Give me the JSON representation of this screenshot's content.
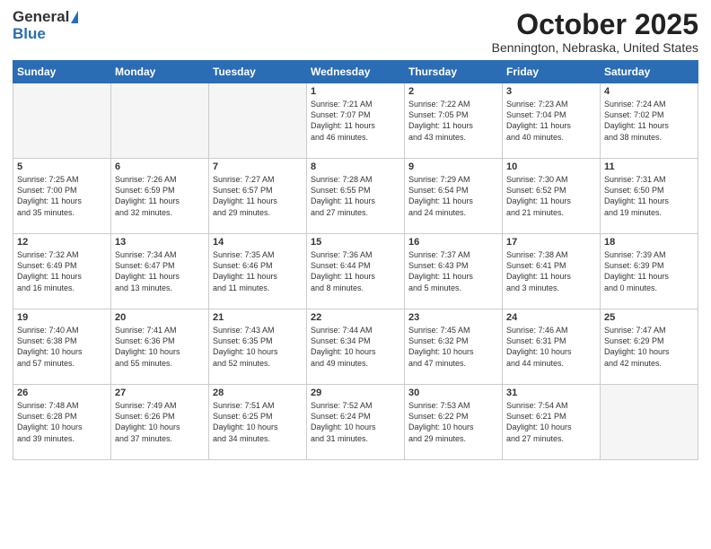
{
  "logo": {
    "general": "General",
    "blue": "Blue"
  },
  "title": "October 2025",
  "subtitle": "Bennington, Nebraska, United States",
  "days_of_week": [
    "Sunday",
    "Monday",
    "Tuesday",
    "Wednesday",
    "Thursday",
    "Friday",
    "Saturday"
  ],
  "weeks": [
    [
      {
        "day": "",
        "info": ""
      },
      {
        "day": "",
        "info": ""
      },
      {
        "day": "",
        "info": ""
      },
      {
        "day": "1",
        "info": "Sunrise: 7:21 AM\nSunset: 7:07 PM\nDaylight: 11 hours\nand 46 minutes."
      },
      {
        "day": "2",
        "info": "Sunrise: 7:22 AM\nSunset: 7:05 PM\nDaylight: 11 hours\nand 43 minutes."
      },
      {
        "day": "3",
        "info": "Sunrise: 7:23 AM\nSunset: 7:04 PM\nDaylight: 11 hours\nand 40 minutes."
      },
      {
        "day": "4",
        "info": "Sunrise: 7:24 AM\nSunset: 7:02 PM\nDaylight: 11 hours\nand 38 minutes."
      }
    ],
    [
      {
        "day": "5",
        "info": "Sunrise: 7:25 AM\nSunset: 7:00 PM\nDaylight: 11 hours\nand 35 minutes."
      },
      {
        "day": "6",
        "info": "Sunrise: 7:26 AM\nSunset: 6:59 PM\nDaylight: 11 hours\nand 32 minutes."
      },
      {
        "day": "7",
        "info": "Sunrise: 7:27 AM\nSunset: 6:57 PM\nDaylight: 11 hours\nand 29 minutes."
      },
      {
        "day": "8",
        "info": "Sunrise: 7:28 AM\nSunset: 6:55 PM\nDaylight: 11 hours\nand 27 minutes."
      },
      {
        "day": "9",
        "info": "Sunrise: 7:29 AM\nSunset: 6:54 PM\nDaylight: 11 hours\nand 24 minutes."
      },
      {
        "day": "10",
        "info": "Sunrise: 7:30 AM\nSunset: 6:52 PM\nDaylight: 11 hours\nand 21 minutes."
      },
      {
        "day": "11",
        "info": "Sunrise: 7:31 AM\nSunset: 6:50 PM\nDaylight: 11 hours\nand 19 minutes."
      }
    ],
    [
      {
        "day": "12",
        "info": "Sunrise: 7:32 AM\nSunset: 6:49 PM\nDaylight: 11 hours\nand 16 minutes."
      },
      {
        "day": "13",
        "info": "Sunrise: 7:34 AM\nSunset: 6:47 PM\nDaylight: 11 hours\nand 13 minutes."
      },
      {
        "day": "14",
        "info": "Sunrise: 7:35 AM\nSunset: 6:46 PM\nDaylight: 11 hours\nand 11 minutes."
      },
      {
        "day": "15",
        "info": "Sunrise: 7:36 AM\nSunset: 6:44 PM\nDaylight: 11 hours\nand 8 minutes."
      },
      {
        "day": "16",
        "info": "Sunrise: 7:37 AM\nSunset: 6:43 PM\nDaylight: 11 hours\nand 5 minutes."
      },
      {
        "day": "17",
        "info": "Sunrise: 7:38 AM\nSunset: 6:41 PM\nDaylight: 11 hours\nand 3 minutes."
      },
      {
        "day": "18",
        "info": "Sunrise: 7:39 AM\nSunset: 6:39 PM\nDaylight: 11 hours\nand 0 minutes."
      }
    ],
    [
      {
        "day": "19",
        "info": "Sunrise: 7:40 AM\nSunset: 6:38 PM\nDaylight: 10 hours\nand 57 minutes."
      },
      {
        "day": "20",
        "info": "Sunrise: 7:41 AM\nSunset: 6:36 PM\nDaylight: 10 hours\nand 55 minutes."
      },
      {
        "day": "21",
        "info": "Sunrise: 7:43 AM\nSunset: 6:35 PM\nDaylight: 10 hours\nand 52 minutes."
      },
      {
        "day": "22",
        "info": "Sunrise: 7:44 AM\nSunset: 6:34 PM\nDaylight: 10 hours\nand 49 minutes."
      },
      {
        "day": "23",
        "info": "Sunrise: 7:45 AM\nSunset: 6:32 PM\nDaylight: 10 hours\nand 47 minutes."
      },
      {
        "day": "24",
        "info": "Sunrise: 7:46 AM\nSunset: 6:31 PM\nDaylight: 10 hours\nand 44 minutes."
      },
      {
        "day": "25",
        "info": "Sunrise: 7:47 AM\nSunset: 6:29 PM\nDaylight: 10 hours\nand 42 minutes."
      }
    ],
    [
      {
        "day": "26",
        "info": "Sunrise: 7:48 AM\nSunset: 6:28 PM\nDaylight: 10 hours\nand 39 minutes."
      },
      {
        "day": "27",
        "info": "Sunrise: 7:49 AM\nSunset: 6:26 PM\nDaylight: 10 hours\nand 37 minutes."
      },
      {
        "day": "28",
        "info": "Sunrise: 7:51 AM\nSunset: 6:25 PM\nDaylight: 10 hours\nand 34 minutes."
      },
      {
        "day": "29",
        "info": "Sunrise: 7:52 AM\nSunset: 6:24 PM\nDaylight: 10 hours\nand 31 minutes."
      },
      {
        "day": "30",
        "info": "Sunrise: 7:53 AM\nSunset: 6:22 PM\nDaylight: 10 hours\nand 29 minutes."
      },
      {
        "day": "31",
        "info": "Sunrise: 7:54 AM\nSunset: 6:21 PM\nDaylight: 10 hours\nand 27 minutes."
      },
      {
        "day": "",
        "info": ""
      }
    ]
  ]
}
